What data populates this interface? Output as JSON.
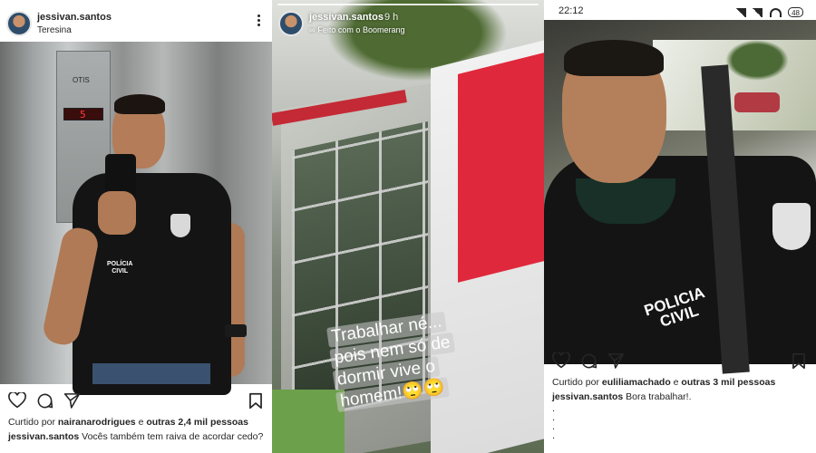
{
  "post1": {
    "username": "jessivan.santos",
    "location": "Teresina",
    "elevator_brand": "OTIS",
    "floor_number": "5",
    "shirt_text_line1": "POLÍCIA",
    "shirt_text_line2": "CIVIL",
    "liked_prefix": "Curtido por",
    "liked_user": "nairanarodrigues",
    "liked_and": "e",
    "liked_others": "outras 2,4 mil pessoas",
    "caption_user": "jessivan.santos",
    "caption_text": "Vocês também tem raiva de acordar cedo?"
  },
  "story": {
    "username": "jessivan.santos",
    "time": "9 h",
    "boomerang_text": "Feito com o Boomerang",
    "boomerang_icon": "∞",
    "text_lines": [
      "Trabalhar né...",
      "pois nem só de",
      "dormir vive o",
      "homem!🙄🙄"
    ]
  },
  "post3": {
    "clock": "22:12",
    "battery": "48",
    "shirt_text_line1": "POLICIA",
    "shirt_text_line2": "CIVIL",
    "liked_prefix": "Curtido por",
    "liked_user": "euliliamachado",
    "liked_and": "e",
    "liked_others": "outras 3 mil pessoas",
    "caption_user": "jessivan.santos",
    "caption_text": "Bora trabalhar!.",
    "dots": [
      ".",
      ".",
      ".",
      "."
    ]
  },
  "colors": {
    "text": "#262626",
    "story_red": "#e0283c"
  },
  "icons": [
    "heart-icon",
    "comment-icon",
    "share-icon",
    "bookmark-icon",
    "more-options-icon",
    "boomerang-icon",
    "signal-icon",
    "wifi-icon",
    "battery-icon"
  ]
}
